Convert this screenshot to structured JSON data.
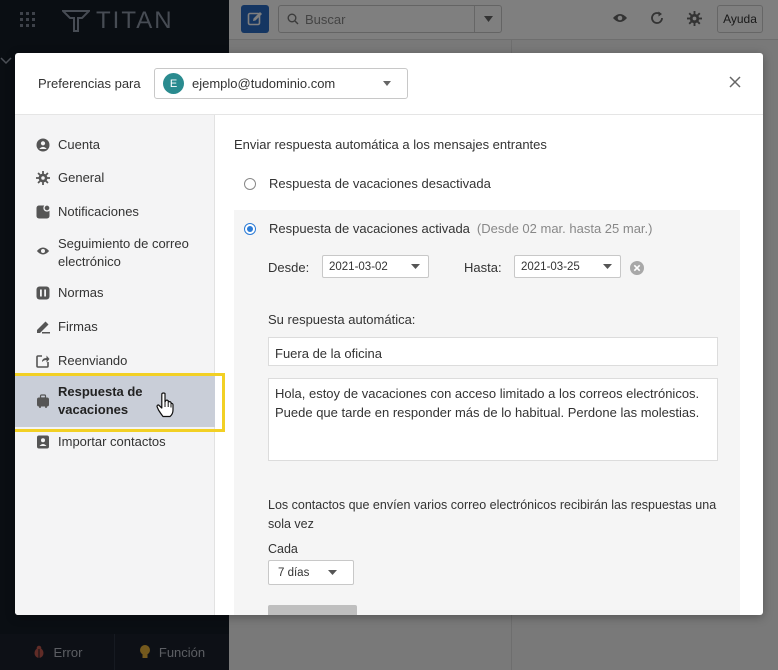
{
  "app": {
    "brand": "TITAN",
    "search_placeholder": "Buscar",
    "help_label": "Ayuda",
    "bottom_error": "Error",
    "bottom_feature": "Función"
  },
  "modal": {
    "prefs_label": "Preferencias para",
    "account_initial": "E",
    "account_email": "ejemplo@tudominio.com"
  },
  "sidebar": {
    "items": [
      {
        "label": "Cuenta",
        "icon": "user-circle-icon"
      },
      {
        "label": "General",
        "icon": "gear-icon"
      },
      {
        "label": "Notificaciones",
        "icon": "notification-icon"
      },
      {
        "label": "Seguimiento de correo electrónico",
        "icon": "eye-icon"
      },
      {
        "label": "Normas",
        "icon": "rules-icon"
      },
      {
        "label": "Firmas",
        "icon": "pen-icon"
      },
      {
        "label": "Reenviando",
        "icon": "forward-icon"
      },
      {
        "label": "Respuesta de vacaciones",
        "icon": "vacation-icon"
      },
      {
        "label": "Importar contactos",
        "icon": "contacts-icon"
      }
    ]
  },
  "autoreply": {
    "heading": "Enviar respuesta automática a los mensajes entrantes",
    "off_label": "Respuesta de vacaciones desactivada",
    "on_label": "Respuesta de vacaciones activada",
    "range_text": "(Desde 02 mar. hasta 25 mar.)",
    "from_label": "Desde:",
    "from_value": "2021-03-02",
    "to_label": "Hasta:",
    "to_value": "2021-03-25",
    "reply_label": "Su respuesta automática:",
    "subject_value": "Fuera de la oficina",
    "body_value": "Hola, estoy de vacaciones con acceso limitado a los correos electrónicos. Puede que tarde en responder más de lo habitual. Perdone las molestias.",
    "contacts_info": "Los contactos que envíen varios correo electrónicos recibirán las respuestas una sola vez",
    "frequency_label": "Cada",
    "frequency_value": "7 días"
  },
  "colors": {
    "accent": "#2b7bd6",
    "highlight": "#f2d024",
    "avatar": "#2a8b8f"
  }
}
